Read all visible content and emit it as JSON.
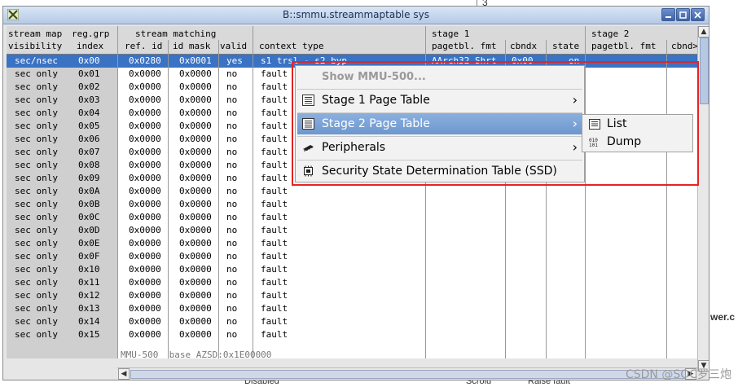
{
  "window": {
    "title": "B::smmu.streammaptable sys"
  },
  "background": {
    "top_text": "3",
    "right_text": "wer.c",
    "bottom_left": "Disabled",
    "bottom_mid": "Scrolu",
    "bottom_right": "Raise fault"
  },
  "columns": {
    "stream_map": "stream map",
    "visibility": "visibility",
    "reg_grp": "reg.grp",
    "index": "index",
    "stream_matching": "stream matching",
    "ref_id": "ref. id",
    "id_mask": "id mask",
    "valid": "valid",
    "context_type": "context type",
    "stage1": "stage 1",
    "s1_pagetbl_fmt": "pagetbl. fmt",
    "s1_cbndx": "cbndx",
    "s1_state": "state",
    "stage2": "stage 2",
    "s2_pagetbl_fmt": "pagetbl. fmt",
    "s2_cbndx": "cbnd>"
  },
  "rows": [
    {
      "visibility": "sec/nsec",
      "index": "0x00",
      "ref_id": "0x0280",
      "id_mask": "0x0001",
      "valid": "yes",
      "context": "s1 trsl - s2 byp",
      "s1_fmt": "AArch32 Shrt",
      "s1_cbndx": "0x00",
      "s1_state": "on"
    },
    {
      "visibility": "sec only",
      "index": "0x01",
      "ref_id": "0x0000",
      "id_mask": "0x0000",
      "valid": "no",
      "context": "fault"
    },
    {
      "visibility": "sec only",
      "index": "0x02",
      "ref_id": "0x0000",
      "id_mask": "0x0000",
      "valid": "no",
      "context": "fault"
    },
    {
      "visibility": "sec only",
      "index": "0x03",
      "ref_id": "0x0000",
      "id_mask": "0x0000",
      "valid": "no",
      "context": "fault"
    },
    {
      "visibility": "sec only",
      "index": "0x04",
      "ref_id": "0x0000",
      "id_mask": "0x0000",
      "valid": "no",
      "context": "fault"
    },
    {
      "visibility": "sec only",
      "index": "0x05",
      "ref_id": "0x0000",
      "id_mask": "0x0000",
      "valid": "no",
      "context": "fault"
    },
    {
      "visibility": "sec only",
      "index": "0x06",
      "ref_id": "0x0000",
      "id_mask": "0x0000",
      "valid": "no",
      "context": "fault"
    },
    {
      "visibility": "sec only",
      "index": "0x07",
      "ref_id": "0x0000",
      "id_mask": "0x0000",
      "valid": "no",
      "context": "fault"
    },
    {
      "visibility": "sec only",
      "index": "0x08",
      "ref_id": "0x0000",
      "id_mask": "0x0000",
      "valid": "no",
      "context": "fault"
    },
    {
      "visibility": "sec only",
      "index": "0x09",
      "ref_id": "0x0000",
      "id_mask": "0x0000",
      "valid": "no",
      "context": "fault"
    },
    {
      "visibility": "sec only",
      "index": "0x0A",
      "ref_id": "0x0000",
      "id_mask": "0x0000",
      "valid": "no",
      "context": "fault"
    },
    {
      "visibility": "sec only",
      "index": "0x0B",
      "ref_id": "0x0000",
      "id_mask": "0x0000",
      "valid": "no",
      "context": "fault"
    },
    {
      "visibility": "sec only",
      "index": "0x0C",
      "ref_id": "0x0000",
      "id_mask": "0x0000",
      "valid": "no",
      "context": "fault"
    },
    {
      "visibility": "sec only",
      "index": "0x0D",
      "ref_id": "0x0000",
      "id_mask": "0x0000",
      "valid": "no",
      "context": "fault"
    },
    {
      "visibility": "sec only",
      "index": "0x0E",
      "ref_id": "0x0000",
      "id_mask": "0x0000",
      "valid": "no",
      "context": "fault"
    },
    {
      "visibility": "sec only",
      "index": "0x0F",
      "ref_id": "0x0000",
      "id_mask": "0x0000",
      "valid": "no",
      "context": "fault"
    },
    {
      "visibility": "sec only",
      "index": "0x10",
      "ref_id": "0x0000",
      "id_mask": "0x0000",
      "valid": "no",
      "context": "fault"
    },
    {
      "visibility": "sec only",
      "index": "0x11",
      "ref_id": "0x0000",
      "id_mask": "0x0000",
      "valid": "no",
      "context": "fault"
    },
    {
      "visibility": "sec only",
      "index": "0x12",
      "ref_id": "0x0000",
      "id_mask": "0x0000",
      "valid": "no",
      "context": "fault"
    },
    {
      "visibility": "sec only",
      "index": "0x13",
      "ref_id": "0x0000",
      "id_mask": "0x0000",
      "valid": "no",
      "context": "fault"
    },
    {
      "visibility": "sec only",
      "index": "0x14",
      "ref_id": "0x0000",
      "id_mask": "0x0000",
      "valid": "no",
      "context": "fault"
    },
    {
      "visibility": "sec only",
      "index": "0x15",
      "ref_id": "0x0000",
      "id_mask": "0x0000",
      "valid": "no",
      "context": "fault"
    }
  ],
  "status": "MMU-500  base AZSD:0x1E00000",
  "menu": {
    "show_mmu": "Show MMU-500...",
    "stage1": "Stage 1 Page Table",
    "stage2": "Stage 2 Page Table",
    "peripherals": "Peripherals",
    "ssd": "Security State Determination Table (SSD)",
    "chevron": "›"
  },
  "submenu": {
    "list": "List",
    "dump": "Dump"
  },
  "watermark": "CSDN @SOC罗三炮",
  "colors": {
    "selection": "#3a72c4",
    "menu_highlight": "#7aa3d7",
    "annotation": "#e62323"
  }
}
